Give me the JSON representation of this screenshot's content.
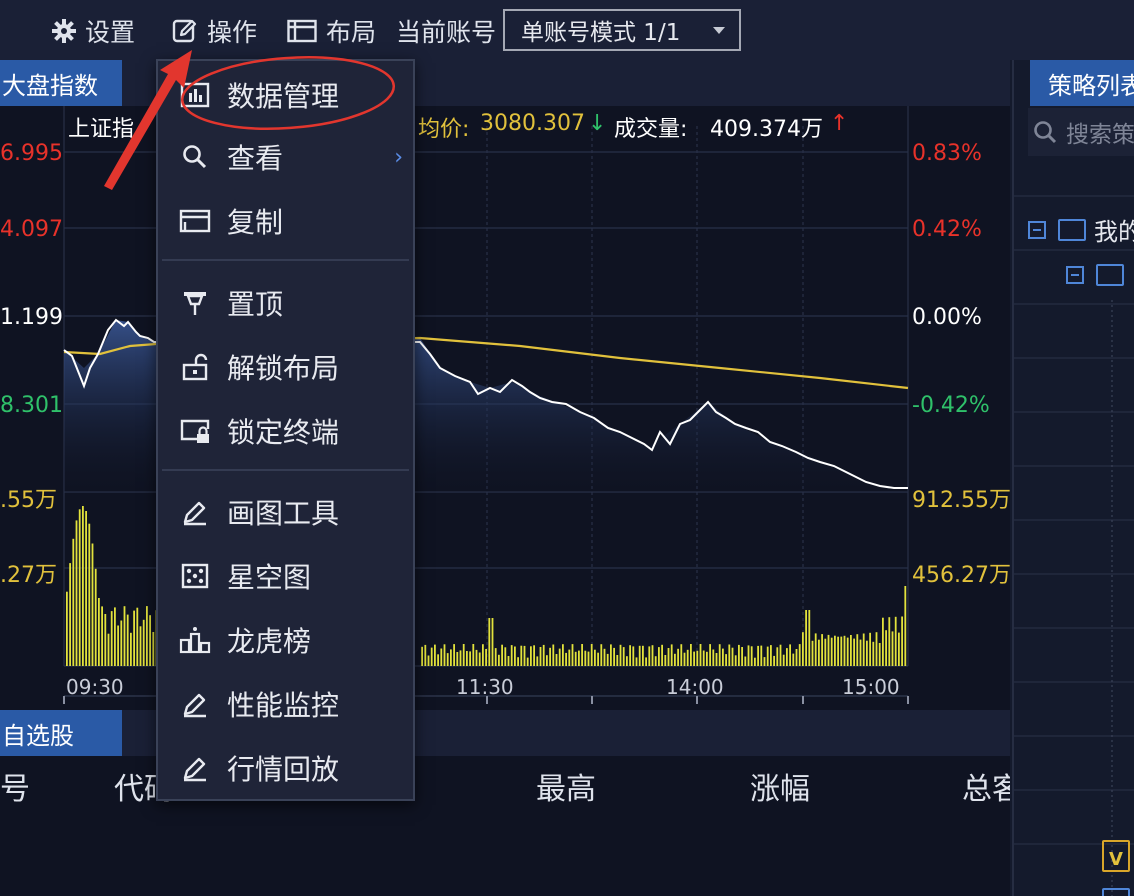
{
  "toolbar": {
    "settings_label": "设置",
    "operate_label": "操作",
    "layout_label": "布局",
    "account_label": "当前账号",
    "account_mode_value": "单账号模式 1/1"
  },
  "market_panel": {
    "tab_label": "大盘指数",
    "index_name": "上证指",
    "avg_price_label": "均价:",
    "avg_price_value": "3080.307",
    "volume_label": "成交量:",
    "volume_value": "409.374万",
    "price_axis_left": [
      "6.995",
      "4.097",
      "1.199",
      "8.301"
    ],
    "percent_axis_right": [
      "0.83%",
      "0.42%",
      "0.00%",
      "-0.42%"
    ],
    "volume_axis_left": [
      ".55万",
      ".27万"
    ],
    "volume_axis_right": [
      "912.55万",
      "456.27万"
    ],
    "time_axis": [
      "09:30",
      "11:30",
      "14:00",
      "15:00"
    ],
    "colors": {
      "up": "#e8322a",
      "down": "#2fc16a",
      "price_line": "#ffffff",
      "avg_line": "#e1c13c",
      "volume_bar": "#e2e23c",
      "accent": "#2a5aa6"
    }
  },
  "operate_menu": {
    "items": [
      {
        "label": "数据管理",
        "icon": "bar-chart-icon"
      },
      {
        "label": "查看",
        "icon": "search-icon",
        "has_submenu": true
      },
      {
        "label": "复制",
        "icon": "window-copy-icon"
      },
      {
        "label": "置顶",
        "icon": "pin-icon"
      },
      {
        "label": "解锁布局",
        "icon": "unlock-icon"
      },
      {
        "label": "锁定终端",
        "icon": "lock-screen-icon"
      },
      {
        "label": "画图工具",
        "icon": "pencil-icon"
      },
      {
        "label": "星空图",
        "icon": "dice-icon"
      },
      {
        "label": "龙虎榜",
        "icon": "podium-icon"
      },
      {
        "label": "性能监控",
        "icon": "pencil-icon"
      },
      {
        "label": "行情回放",
        "icon": "pencil-icon"
      }
    ],
    "submenu_arrow": "›"
  },
  "watchlist": {
    "tab_label": "自选股",
    "columns": [
      "号",
      "代码",
      "最高",
      "涨幅",
      "总客"
    ]
  },
  "strategy_panel": {
    "tab_label": "策略列表",
    "search_placeholder": "搜索策",
    "tree_root_label": "我的"
  },
  "chart_data": {
    "type": "line",
    "x": [
      "09:30",
      "11:30",
      "14:00",
      "15:00"
    ],
    "series": [],
    "yticks_price": [
      "6.995",
      "4.097",
      "1.199",
      "8.301"
    ],
    "yticks_percent": [
      "0.83%",
      "0.42%",
      "0.00%",
      "-0.42%"
    ],
    "grid": true
  }
}
